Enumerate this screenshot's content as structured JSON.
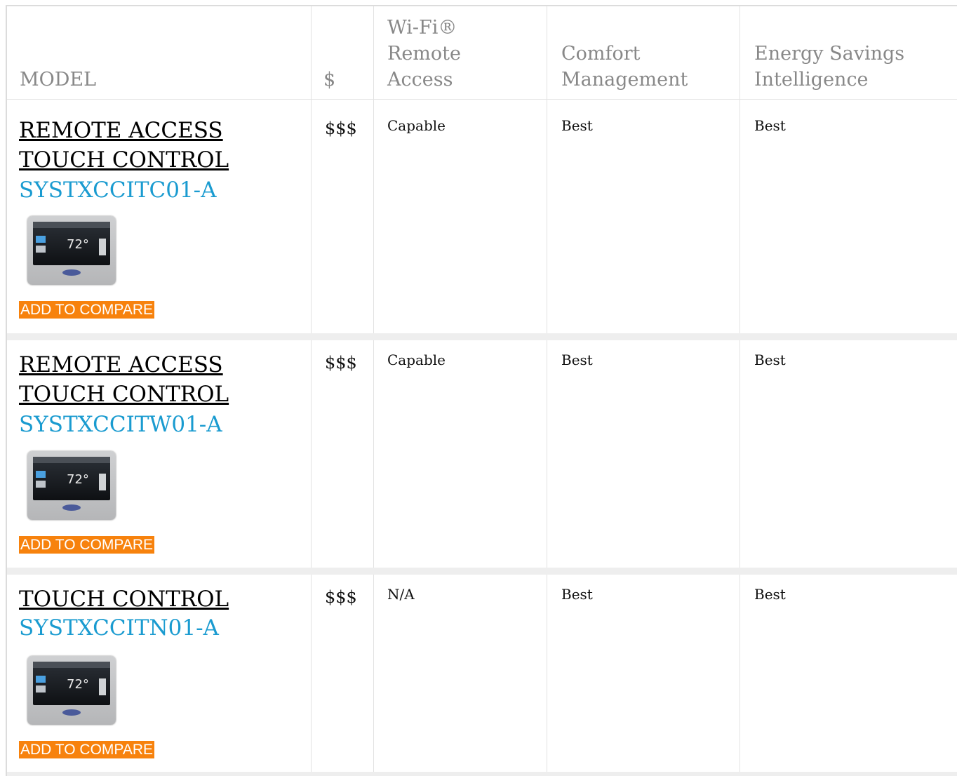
{
  "headers": {
    "model": "MODEL",
    "price": "$",
    "wifi": "Wi-Fi® Remote Access",
    "comfort": "Comfort Management",
    "energy": "Energy Savings Intelligence"
  },
  "rows": [
    {
      "name": "REMOTE ACCESS TOUCH CONTROL",
      "sku": "SYSTXCCITC01-A",
      "price": "$$$",
      "wifi": "Capable",
      "comfort": "Best",
      "energy": "Best",
      "compare_label": "ADD TO COMPARE",
      "thumb_temp": "72°"
    },
    {
      "name": "REMOTE ACCESS TOUCH CONTROL",
      "sku": "SYSTXCCITW01-A",
      "price": "$$$",
      "wifi": "Capable",
      "comfort": "Best",
      "energy": "Best",
      "compare_label": "ADD TO COMPARE",
      "thumb_temp": "72°"
    },
    {
      "name": "TOUCH CONTROL",
      "sku": "SYSTXCCITN01-A",
      "price": "$$$",
      "wifi": "N/A",
      "comfort": "Best",
      "energy": "Best",
      "compare_label": "ADD TO COMPARE",
      "thumb_temp": "72°"
    }
  ],
  "colors": {
    "sku": "#1a9bd0",
    "compare_bg": "#f7820d",
    "header_text": "#888888"
  }
}
